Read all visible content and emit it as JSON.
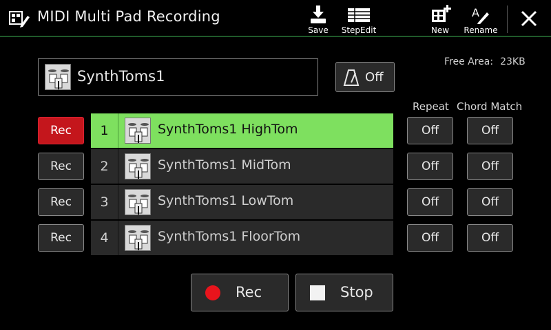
{
  "header": {
    "title": "MIDI Multi Pad Recording",
    "toolbar": [
      {
        "id": "save",
        "label": "Save",
        "icon": "save-icon"
      },
      {
        "id": "stepedit",
        "label": "StepEdit",
        "icon": "step-edit-icon"
      },
      {
        "id": "new",
        "label": "New",
        "icon": "new-icon"
      },
      {
        "id": "rename",
        "label": "Rename",
        "icon": "rename-icon"
      }
    ],
    "close_icon": "close-icon"
  },
  "bank": {
    "name": "SynthToms1",
    "metronome_label": "Off"
  },
  "free_area": {
    "label": "Free Area:",
    "value": "23KB"
  },
  "columns": {
    "repeat": "Repeat",
    "chord_match": "Chord Match"
  },
  "pads": [
    {
      "rec": "Rec",
      "number": "1",
      "name": "SynthToms1 HighTom",
      "repeat": "Off",
      "chord_match": "Off",
      "selected": true,
      "rec_active": true
    },
    {
      "rec": "Rec",
      "number": "2",
      "name": "SynthToms1 MidTom",
      "repeat": "Off",
      "chord_match": "Off",
      "selected": false,
      "rec_active": false
    },
    {
      "rec": "Rec",
      "number": "3",
      "name": "SynthToms1 LowTom",
      "repeat": "Off",
      "chord_match": "Off",
      "selected": false,
      "rec_active": false
    },
    {
      "rec": "Rec",
      "number": "4",
      "name": "SynthToms1 FloorTom",
      "repeat": "Off",
      "chord_match": "Off",
      "selected": false,
      "rec_active": false
    }
  ],
  "transport": {
    "rec_label": "Rec",
    "stop_label": "Stop"
  },
  "colors": {
    "selected_row": "#7ee05f",
    "rec_active": "#c4161c",
    "rec_dot": "#e8141c"
  }
}
